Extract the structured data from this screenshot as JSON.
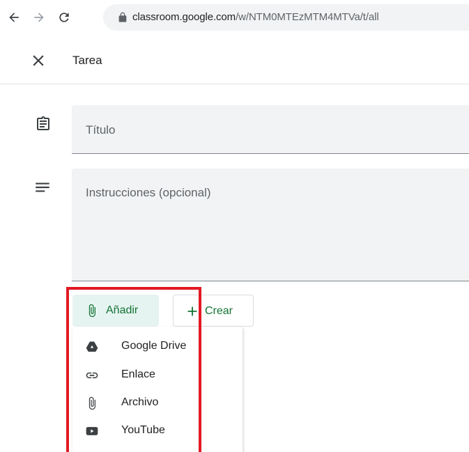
{
  "browser": {
    "url_host": "classroom.google.com",
    "url_path": "/w/NTM0MTEzMTM4MTVa/t/all"
  },
  "task": {
    "title": "Tarea"
  },
  "form": {
    "title_placeholder": "Título",
    "instructions_placeholder": "Instrucciones (opcional)"
  },
  "actions": {
    "add_label": "Añadir",
    "create_label": "Crear"
  },
  "add_menu": {
    "items": [
      {
        "label": "Google Drive",
        "icon": "google-drive-icon"
      },
      {
        "label": "Enlace",
        "icon": "link-icon"
      },
      {
        "label": "Archivo",
        "icon": "attachment-icon"
      },
      {
        "label": "YouTube",
        "icon": "youtube-icon"
      }
    ]
  },
  "colors": {
    "accent_green": "#137333",
    "add_button_bg": "#e6f4f1",
    "field_bg": "#f1f3f4",
    "highlight": "#e21a24"
  }
}
